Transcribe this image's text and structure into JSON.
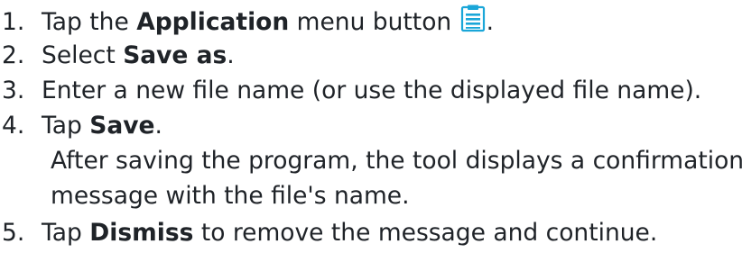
{
  "steps": [
    {
      "num": "1.",
      "pre": "Tap the ",
      "bold": "Application",
      "post": " menu button",
      "tail": "."
    },
    {
      "num": "2.",
      "pre": "Select ",
      "bold": "Save as",
      "post": "."
    },
    {
      "num": "3.",
      "pre": "Enter a new file name (or use the displayed file name)."
    },
    {
      "num": "4.",
      "pre": "Tap ",
      "bold": "Save",
      "post": "."
    },
    {
      "num": "5.",
      "pre": "Tap ",
      "bold": "Dismiss",
      "post": " to remove the message and continue."
    }
  ],
  "note": {
    "line1": "After saving the program, the tool displays a confirmation",
    "line2": "message with the file's name."
  },
  "icons": {
    "application_menu": "clipboard-icon"
  },
  "colors": {
    "text": "#1f2328",
    "icon": "#1aa6d8"
  }
}
